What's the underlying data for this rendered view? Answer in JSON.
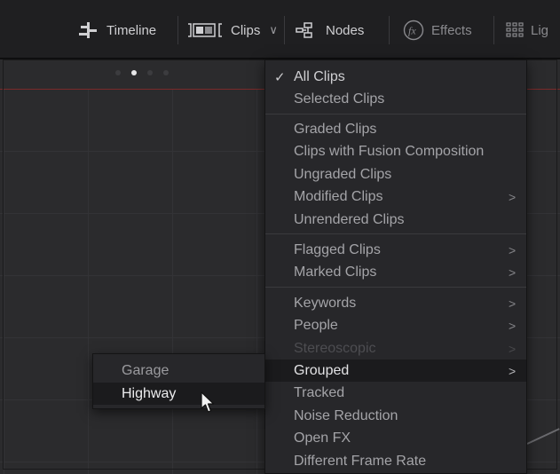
{
  "toolbar": {
    "items": [
      {
        "label": "Timeline",
        "icon": "timeline-icon"
      },
      {
        "label": "Clips",
        "icon": "clips-icon",
        "chevron": "∨"
      },
      {
        "label": "Nodes",
        "icon": "nodes-icon"
      },
      {
        "label": "Effects",
        "icon": "fx-icon"
      },
      {
        "label": "Lig",
        "icon": "lightbox-icon"
      }
    ]
  },
  "viewer": {
    "page_dots": 4,
    "active_dot": 1
  },
  "clips_menu": {
    "selected": "All Clips",
    "check_glyph": "✓",
    "submenu_glyph": ">",
    "items": [
      {
        "label": "All Clips",
        "checked": true,
        "has_submenu": false
      },
      {
        "label": "Selected Clips",
        "has_submenu": false
      },
      {
        "label": "Graded Clips",
        "has_submenu": false
      },
      {
        "label": "Clips with Fusion Composition",
        "has_submenu": false
      },
      {
        "label": "Ungraded Clips",
        "has_submenu": false
      },
      {
        "label": "Modified Clips",
        "has_submenu": true
      },
      {
        "label": "Unrendered Clips",
        "has_submenu": false
      },
      {
        "label": "Flagged Clips",
        "has_submenu": true
      },
      {
        "label": "Marked Clips",
        "has_submenu": true
      },
      {
        "label": "Keywords",
        "has_submenu": true
      },
      {
        "label": "People",
        "has_submenu": true
      },
      {
        "label": "Stereoscopic",
        "has_submenu": true,
        "disabled": true
      },
      {
        "label": "Grouped",
        "has_submenu": true,
        "highlighted": true
      },
      {
        "label": "Tracked",
        "has_submenu": false
      },
      {
        "label": "Noise Reduction",
        "has_submenu": false
      },
      {
        "label": "Open FX",
        "has_submenu": false
      },
      {
        "label": "Different Frame Rate",
        "has_submenu": false
      }
    ]
  },
  "grouped_submenu": {
    "items": [
      {
        "label": "Garage"
      },
      {
        "label": "Highway",
        "highlighted": true
      }
    ]
  },
  "colors": {
    "toolbar_bg": "#1f1f21",
    "menu_bg": "#27272a",
    "highlight_bg": "#1b1b1d",
    "playhead_red": "#7b2a2a"
  }
}
